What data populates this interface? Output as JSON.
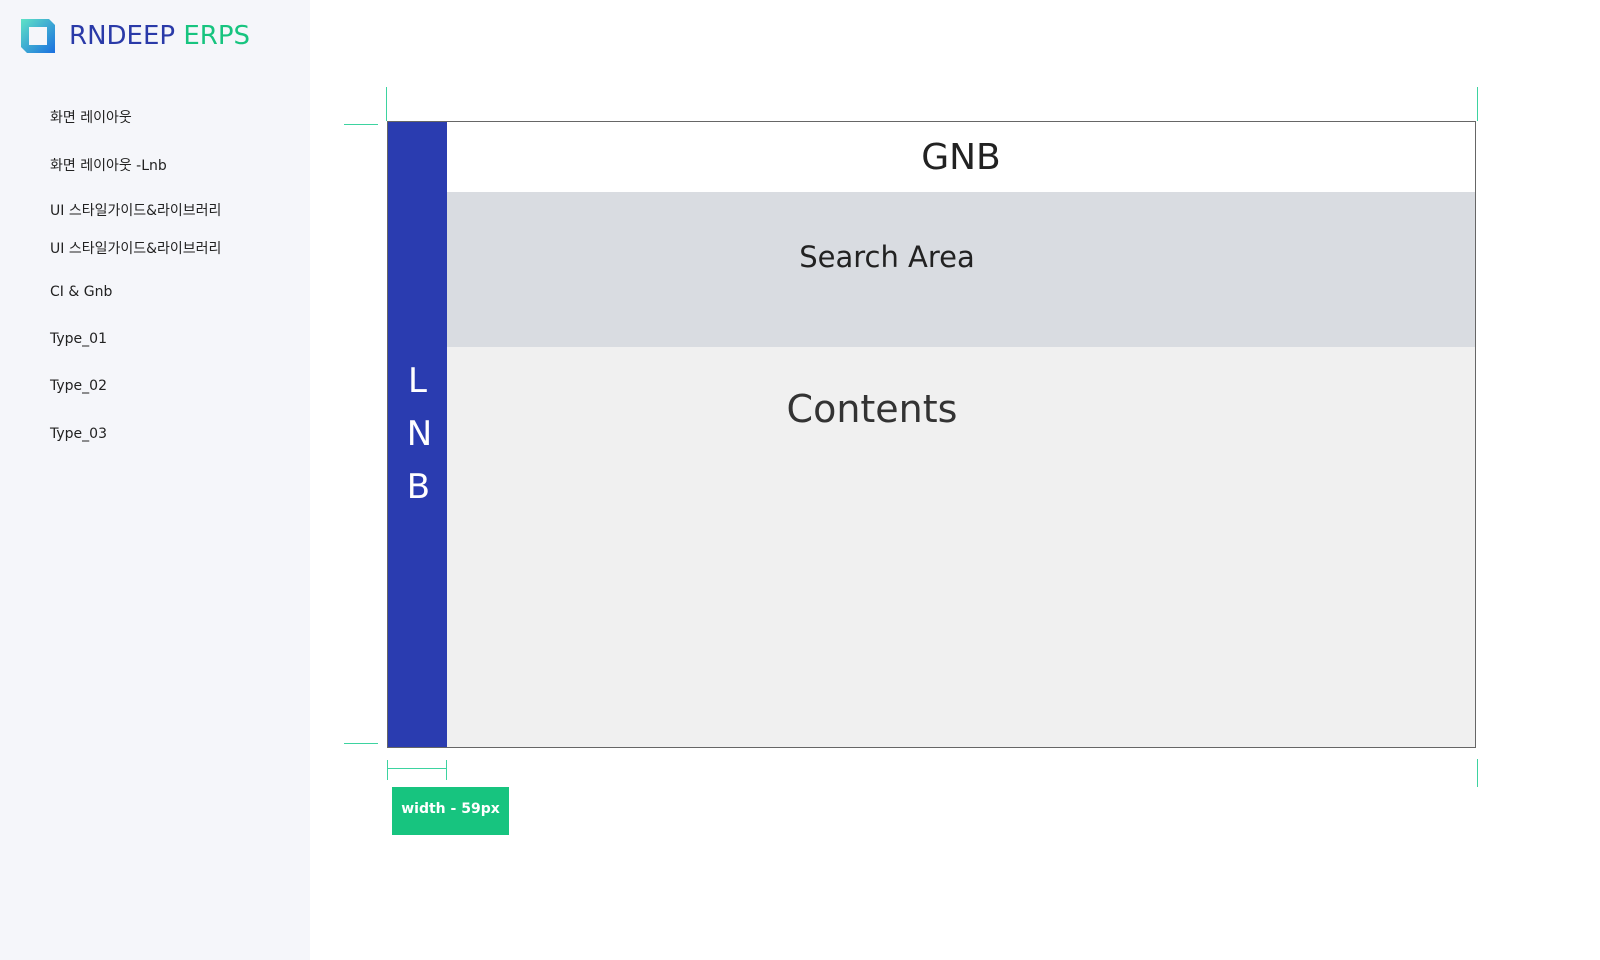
{
  "brand": {
    "name_part1": "RNDEEP",
    "name_part2": "ERPS",
    "colors": {
      "primary": "#2a3aa8",
      "accent": "#17c47f"
    }
  },
  "nav": {
    "items": [
      {
        "label": "화면 레이아웃"
      },
      {
        "label": "화면 레이아웃 -Lnb"
      },
      {
        "label": "UI 스타일가이드&라이브러리"
      },
      {
        "label": "UI 스타일가이드&라이브러리"
      },
      {
        "label": "CI & Gnb"
      },
      {
        "label": "Type_01"
      },
      {
        "label": "Type_02"
      },
      {
        "label": "Type_03"
      }
    ]
  },
  "diagram": {
    "lnb_label": "LNB",
    "gnb_label": "GNB",
    "search_label": "Search Area",
    "contents_label": "Contents",
    "width_badge": "width - 59px",
    "colors": {
      "lnb": "#2a3cb0",
      "search_bg": "#d9dce1",
      "contents_bg": "#f0f0f0",
      "guide": "#3dd3a0",
      "badge": "#17c47f"
    }
  }
}
